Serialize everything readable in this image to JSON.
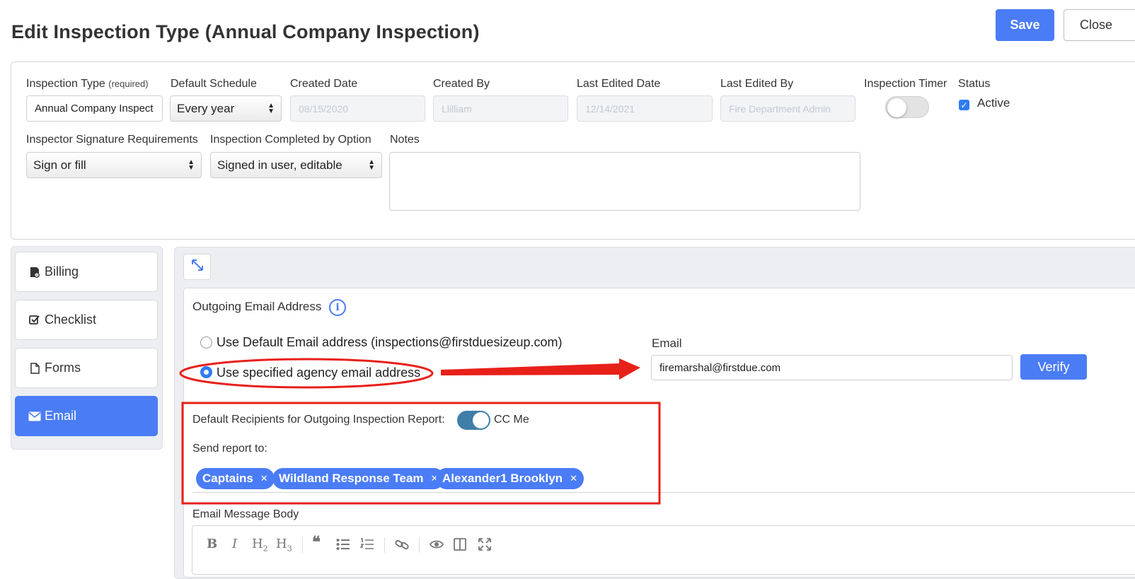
{
  "page": {
    "title": "Edit Inspection Type (Annual Company Inspection)"
  },
  "header": {
    "save_label": "Save",
    "close_label": "Close"
  },
  "form": {
    "inspection_type": {
      "label": "Inspection Type",
      "hint": "(required)",
      "value": "Annual Company Inspect"
    },
    "default_schedule": {
      "label": "Default Schedule",
      "value": "Every year"
    },
    "created_date": {
      "label": "Created Date",
      "value": "08/15/2020"
    },
    "created_by": {
      "label": "Created By",
      "value": "Llilliam"
    },
    "last_edited_date": {
      "label": "Last Edited Date",
      "value": "12/14/2021"
    },
    "last_edited_by": {
      "label": "Last Edited By",
      "value": "Fire Department Admin"
    },
    "inspection_timer": {
      "label": "Inspection Timer",
      "on": false
    },
    "status": {
      "label": "Status",
      "checkbox_label": "Active",
      "checked": true
    },
    "signature_req": {
      "label": "Inspector Signature Requirements",
      "value": "Sign or fill"
    },
    "completed_by": {
      "label": "Inspection Completed by Option",
      "value": "Signed in user, editable"
    },
    "notes": {
      "label": "Notes",
      "value": ""
    }
  },
  "sidebar": {
    "items": [
      {
        "label": "Billing",
        "icon": "billing-icon",
        "active": false
      },
      {
        "label": "Checklist",
        "icon": "checklist-icon",
        "active": false
      },
      {
        "label": "Forms",
        "icon": "file-icon",
        "active": false
      },
      {
        "label": "Email",
        "icon": "envelope-icon",
        "active": true
      }
    ]
  },
  "email": {
    "outgoing_label": "Outgoing Email Address",
    "option_default": "Use Default Email address (inspections@firstduesizeup.com)",
    "option_specified": "Use specified agency email address",
    "selected_option": "specified",
    "email_label": "Email",
    "email_value": "firemarshal@firstdue.com",
    "verify_label": "Verify",
    "recipients_label": "Default Recipients for Outgoing Inspection Report:",
    "cc_me_label": "CC Me",
    "cc_me_on": true,
    "send_to_label": "Send report to:",
    "recipients": [
      "Captains",
      "Wildland Response Team",
      "Alexander1 Brooklyn"
    ],
    "body_label": "Email Message Body"
  },
  "annotations": {
    "color": "#e8201a"
  },
  "colors": {
    "accent": "#4a7cf6",
    "toggle_on": "#3f7ea8",
    "checkbox": "#2f7cf0"
  }
}
